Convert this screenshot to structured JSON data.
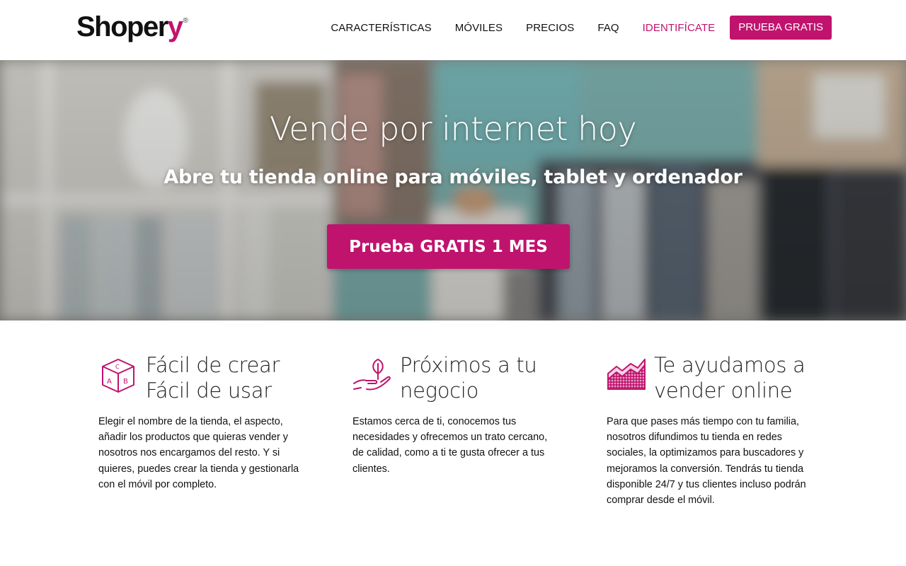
{
  "header": {
    "logo": {
      "text_main": "Shoper",
      "text_accent": "y",
      "reg": "®"
    },
    "nav": [
      {
        "label": "CARACTERÍSTICAS"
      },
      {
        "label": "MÓVILES"
      },
      {
        "label": "PRECIOS"
      },
      {
        "label": "FAQ"
      },
      {
        "label": "IDENTIFÍCATE"
      }
    ],
    "cta_label": "PRUEBA GRATIS"
  },
  "hero": {
    "title": "Vende por internet hoy",
    "subtitle": "Abre tu tienda online para móviles, tablet y ordenador",
    "cta_label": "Prueba GRATIS 1 MES"
  },
  "features": [
    {
      "icon": "abc-blocks-icon",
      "title": "Fácil de crear\nFácil de usar",
      "desc": "Elegir el nombre de la tienda, el aspecto, añadir los productos que quieras vender y nosotros nos encargamos del resto. Y si quieres, puedes crear la tienda y gestionarla con el móvil por completo."
    },
    {
      "icon": "hand-plant-icon",
      "title": "Próximos a tu\nnegocio",
      "desc": "Estamos cerca de ti, conocemos tus necesidades y ofrecemos un trato cercano, de calidad, como a ti te gusta ofrecer a tus clientes."
    },
    {
      "icon": "growth-chart-icon",
      "title": "Te ayudamos a\nvender online",
      "desc": "Para que pases más tiempo con tu familia, nosotros difundimos tu tienda en redes sociales, la optimizamos para buscadores y mejoramos la conversión. Tendrás tu tienda disponible 24/7 y tus clientes incluso podrán comprar desde el móvil."
    }
  ],
  "colors": {
    "accent": "#c0136e"
  }
}
